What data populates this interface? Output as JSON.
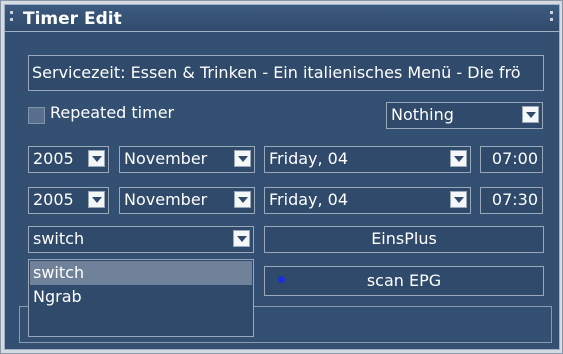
{
  "window": {
    "title": "Timer Edit"
  },
  "service_field": {
    "value": "Servicezeit: Essen & Trinken - Ein italienisches Menü - Die frö"
  },
  "repeated_timer": {
    "label": "Repeated timer",
    "checked": false
  },
  "after_action": {
    "selected": "Nothing"
  },
  "start": {
    "year": "2005",
    "month": "November",
    "day": "Friday, 04",
    "time": "07:00"
  },
  "end": {
    "year": "2005",
    "month": "November",
    "day": "Friday, 04",
    "time": "07:30"
  },
  "type_select": {
    "selected": "switch",
    "options": [
      "switch",
      "Ngrab"
    ],
    "highlighted_index": 0
  },
  "channel_button": {
    "label": "EinsPlus"
  },
  "scan_epg_button": {
    "label": "scan EPG",
    "indicator_color": "#1b2fd8"
  },
  "colors": {
    "titlebar": "#3d5b80",
    "panel": "#334f72",
    "field": "#2f4a6b",
    "highlight": "#6f8299"
  }
}
